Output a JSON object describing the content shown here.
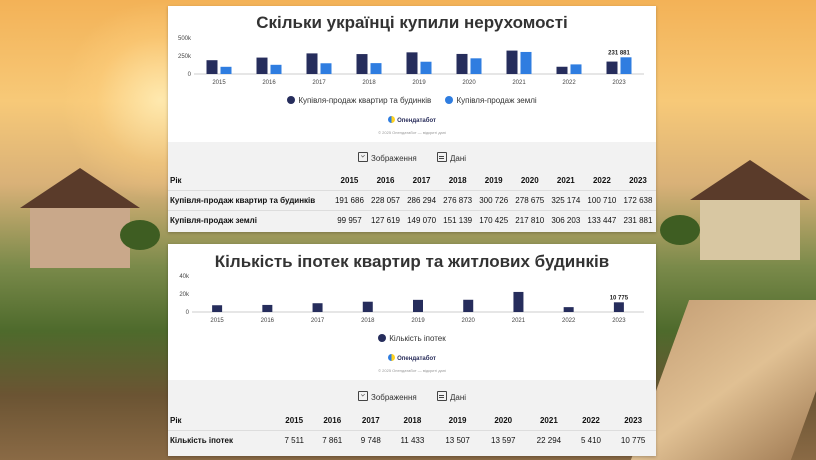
{
  "chart1": {
    "title": "Скільки українці купили нерухомості",
    "legend": [
      "Купівля-продаж квартир та будинків",
      "Купівля-продаж землі"
    ],
    "colors": [
      "#262d5c",
      "#2f7de0"
    ],
    "logo": "Опендатабот",
    "credit": "© 2025 Опендатабот — відкриті дані",
    "actions": {
      "image": "Зображення",
      "data": "Дані"
    },
    "yticks": [
      "500k",
      "250k",
      "0"
    ],
    "highlight_label": "231 881",
    "table": {
      "header": "Рік",
      "years": [
        "2015",
        "2016",
        "2017",
        "2018",
        "2019",
        "2020",
        "2021",
        "2022",
        "2023"
      ],
      "rows": [
        {
          "label": "Купівля-продаж квартир та будинків",
          "values": [
            "191 686",
            "228 057",
            "286 294",
            "276 873",
            "300 726",
            "278 675",
            "325 174",
            "100 710",
            "172 638"
          ]
        },
        {
          "label": "Купівля-продаж землі",
          "values": [
            "99 957",
            "127 619",
            "149 070",
            "151 139",
            "170 425",
            "217 810",
            "306 203",
            "133 447",
            "231 881"
          ]
        }
      ]
    }
  },
  "chart2": {
    "title": "Кількість іпотек квартир та житлових будинків",
    "legend": [
      "Кількість іпотек"
    ],
    "colors": [
      "#262d5c"
    ],
    "logo": "Опендатабот",
    "credit": "© 2025 Опендатабот — відкриті дані",
    "actions": {
      "image": "Зображення",
      "data": "Дані"
    },
    "yticks": [
      "40k",
      "20k",
      "0"
    ],
    "highlight_label": "10 775",
    "table": {
      "header": "Рік",
      "years": [
        "2015",
        "2016",
        "2017",
        "2018",
        "2019",
        "2020",
        "2021",
        "2022",
        "2023"
      ],
      "rows": [
        {
          "label": "Кількість іпотек",
          "values": [
            "7 511",
            "7 861",
            "9 748",
            "11 433",
            "13 507",
            "13 597",
            "22 294",
            "5 410",
            "10 775"
          ]
        }
      ]
    }
  },
  "chart_data": [
    {
      "type": "bar",
      "title": "Скільки українці купили нерухомості",
      "categories": [
        "2015",
        "2016",
        "2017",
        "2018",
        "2019",
        "2020",
        "2021",
        "2022",
        "2023"
      ],
      "series": [
        {
          "name": "Купівля-продаж квартир та будинків",
          "values": [
            191686,
            228057,
            286294,
            276873,
            300726,
            278675,
            325174,
            100710,
            172638
          ]
        },
        {
          "name": "Купівля-продаж землі",
          "values": [
            99957,
            127619,
            149070,
            151139,
            170425,
            217810,
            306203,
            133447,
            231881
          ]
        }
      ],
      "ylim": [
        0,
        500000
      ],
      "legend": "bottom",
      "grid": false
    },
    {
      "type": "bar",
      "title": "Кількість іпотек квартир та житлових будинків",
      "categories": [
        "2015",
        "2016",
        "2017",
        "2018",
        "2019",
        "2020",
        "2021",
        "2022",
        "2023"
      ],
      "series": [
        {
          "name": "Кількість іпотек",
          "values": [
            7511,
            7861,
            9748,
            11433,
            13507,
            13597,
            22294,
            5410,
            10775
          ]
        }
      ],
      "ylim": [
        0,
        40000
      ],
      "legend": "bottom",
      "grid": false
    }
  ]
}
